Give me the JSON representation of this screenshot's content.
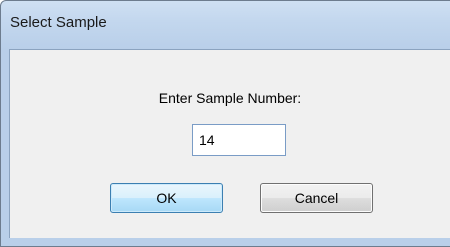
{
  "window": {
    "title": "Select Sample"
  },
  "dialog": {
    "prompt": "Enter Sample Number:",
    "sample_number_value": "14",
    "ok_label": "OK",
    "cancel_label": "Cancel"
  },
  "colors": {
    "title_gradient_top": "#cfe0f3",
    "title_gradient_bottom": "#b9cfe9",
    "client_background": "#f0f0f0",
    "ok_border": "#3c7fb1",
    "cancel_border": "#707070"
  }
}
